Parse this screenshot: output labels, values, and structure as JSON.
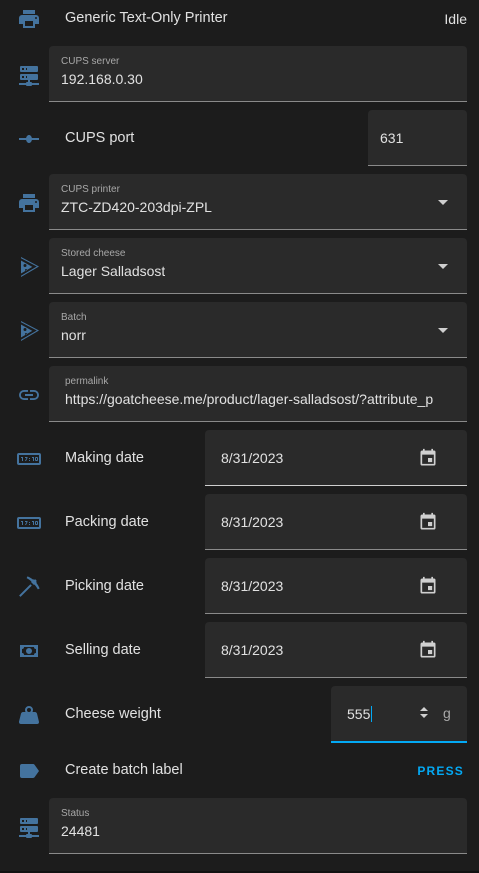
{
  "printer": {
    "name": "Generic Text-Only Printer",
    "state": "Idle"
  },
  "cups_server": {
    "label": "CUPS server",
    "value": "192.168.0.30"
  },
  "cups_port": {
    "label": "CUPS port",
    "value": "631"
  },
  "cups_printer": {
    "label": "CUPS printer",
    "value": "ZTC-ZD420-203dpi-ZPL"
  },
  "stored_cheese": {
    "label": "Stored cheese",
    "value": "Lager Salladsost"
  },
  "batch": {
    "label": "Batch",
    "value": "norr"
  },
  "permalink": {
    "label": "permalink",
    "value": "https://goatcheese.me/product/lager-salladsost/?attribute_p"
  },
  "making_date": {
    "label": "Making date",
    "value": "8/31/2023"
  },
  "packing_date": {
    "label": "Packing date",
    "value": "8/31/2023"
  },
  "picking_date": {
    "label": "Picking date",
    "value": "8/31/2023"
  },
  "selling_date": {
    "label": "Selling date",
    "value": "8/31/2023"
  },
  "cheese_weight": {
    "label": "Cheese weight",
    "value": "555",
    "unit": "g"
  },
  "create_batch_label": {
    "label": "Create batch label",
    "action": "PRESS"
  },
  "status": {
    "label": "Status",
    "value": "24481"
  },
  "colors": {
    "icon": "#44739e",
    "accent": "#03a9f4",
    "background": "#1c1c1c",
    "field": "#2a2a2a"
  },
  "icons": {
    "printer": "printer-icon",
    "server": "server-network-icon",
    "port": "ray-vertex-icon",
    "cheese": "cheese-icon",
    "link": "link-icon",
    "clock": "clock-digital-icon",
    "pick": "pickaxe-icon",
    "cash": "cash-icon",
    "weight": "weight-icon",
    "label": "label-icon",
    "calendar": "calendar-icon"
  }
}
